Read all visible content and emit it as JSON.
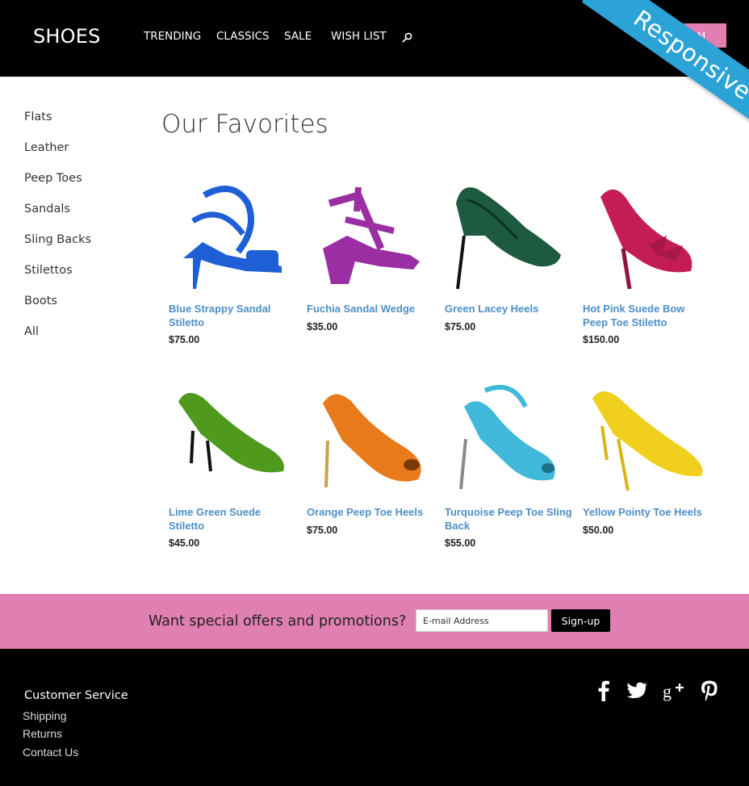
{
  "header": {
    "logo": "SHOES",
    "nav": [
      "TRENDING",
      "CLASSICS",
      "SALE",
      "WISH LIST"
    ],
    "search_icon": "magnifier-icon",
    "ribbon_label": "Responsive",
    "pink_button_label": "M"
  },
  "sidebar": {
    "items": [
      "Flats",
      "Leather",
      "Peep Toes",
      "Sandals",
      "Sling Backs",
      "Stilettos",
      "Boots",
      "All"
    ]
  },
  "main": {
    "title": "Our Favorites",
    "products": [
      {
        "name": "Blue Strappy Sandal Stiletto",
        "price": "$75.00",
        "color": "#1f5fd6"
      },
      {
        "name": "Fuchia Sandal Wedge",
        "price": "$35.00",
        "color": "#9c2ea3"
      },
      {
        "name": "Green Lacey Heels",
        "price": "$75.00",
        "color": "#1e5a3f"
      },
      {
        "name": "Hot Pink Suede Bow Peep Toe Stiletto",
        "price": "$150.00",
        "color": "#c41d56"
      },
      {
        "name": "Lime Green Suede Stiletto",
        "price": "$45.00",
        "color": "#4f9a1c"
      },
      {
        "name": "Orange Peep Toe Heels",
        "price": "$75.00",
        "color": "#e87a1c"
      },
      {
        "name": "Turquoise Peep Toe Sling Back",
        "price": "$55.00",
        "color": "#3fb8d9"
      },
      {
        "name": "Yellow Pointy Toe Heels",
        "price": "$50.00",
        "color": "#f0cf1f"
      }
    ]
  },
  "promo": {
    "text": "Want special offers and promotions?",
    "email_placeholder": "E-mail Address",
    "signup_label": "Sign-up"
  },
  "footer": {
    "title": "Customer Service",
    "links": [
      "Shipping",
      "Returns",
      "Contact Us"
    ],
    "social": [
      "facebook-icon",
      "twitter-icon",
      "google-plus-icon",
      "pinterest-icon"
    ]
  },
  "colors": {
    "accent_pink": "#e07fb1",
    "ribbon_blue": "#2ba3d6",
    "link_blue": "#4d8fc6"
  }
}
